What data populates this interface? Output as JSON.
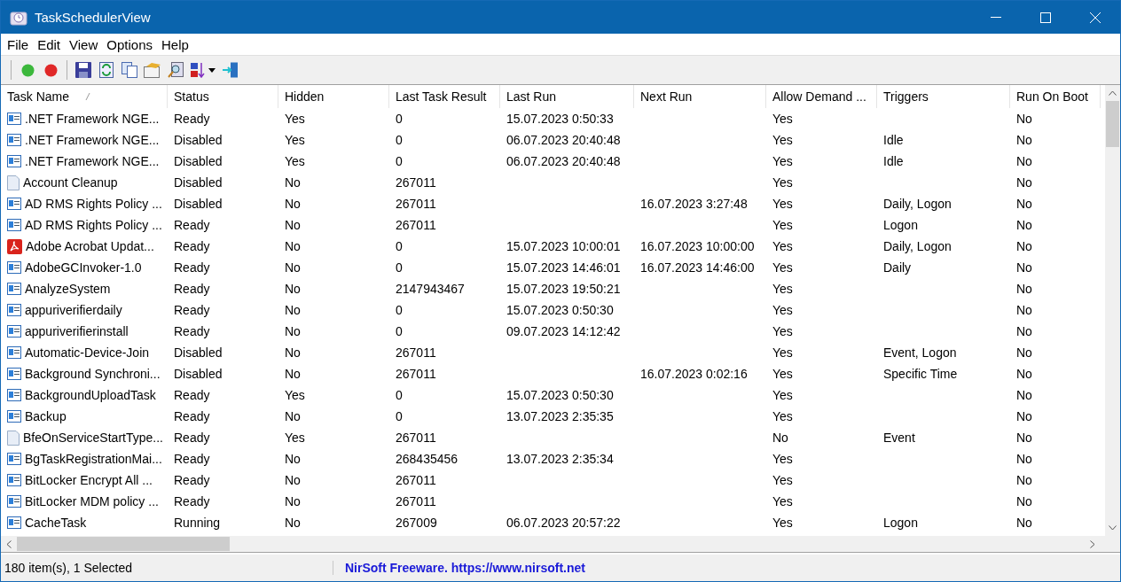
{
  "window": {
    "title": "TaskSchedulerView"
  },
  "menu": [
    "File",
    "Edit",
    "View",
    "Options",
    "Help"
  ],
  "table": {
    "columns": [
      {
        "label": "Task Name",
        "sorted": true
      },
      {
        "label": "Status",
        "sorted": false
      },
      {
        "label": "Hidden",
        "sorted": false
      },
      {
        "label": "Last Task Result",
        "sorted": false
      },
      {
        "label": "Last Run",
        "sorted": false
      },
      {
        "label": "Next Run",
        "sorted": false
      },
      {
        "label": "Allow Demand ...",
        "sorted": false
      },
      {
        "label": "Triggers",
        "sorted": false
      },
      {
        "label": "Run On Boot",
        "sorted": false
      }
    ],
    "rows": [
      {
        "kind": "task",
        "cells": [
          ".NET Framework NGE...",
          "Ready",
          "Yes",
          "0",
          "15.07.2023 0:50:33",
          "",
          "Yes",
          "",
          "No"
        ]
      },
      {
        "kind": "task",
        "cells": [
          ".NET Framework NGE...",
          "Disabled",
          "Yes",
          "0",
          "06.07.2023 20:40:48",
          "",
          "Yes",
          "Idle",
          "No"
        ]
      },
      {
        "kind": "task",
        "cells": [
          ".NET Framework NGE...",
          "Disabled",
          "Yes",
          "0",
          "06.07.2023 20:40:48",
          "",
          "Yes",
          "Idle",
          "No"
        ]
      },
      {
        "kind": "document",
        "cells": [
          "Account Cleanup",
          "Disabled",
          "No",
          "267011",
          "",
          "",
          "Yes",
          "",
          "No"
        ]
      },
      {
        "kind": "task",
        "cells": [
          "AD RMS Rights Policy ...",
          "Disabled",
          "No",
          "267011",
          "",
          "16.07.2023 3:27:48",
          "Yes",
          "Daily, Logon",
          "No"
        ]
      },
      {
        "kind": "task",
        "cells": [
          "AD RMS Rights Policy ...",
          "Ready",
          "No",
          "267011",
          "",
          "",
          "Yes",
          "Logon",
          "No"
        ]
      },
      {
        "kind": "pdf",
        "cells": [
          "Adobe Acrobat Updat...",
          "Ready",
          "No",
          "0",
          "15.07.2023 10:00:01",
          "16.07.2023 10:00:00",
          "Yes",
          "Daily, Logon",
          "No"
        ]
      },
      {
        "kind": "task",
        "cells": [
          "AdobeGCInvoker-1.0",
          "Ready",
          "No",
          "0",
          "15.07.2023 14:46:01",
          "16.07.2023 14:46:00",
          "Yes",
          "Daily",
          "No"
        ]
      },
      {
        "kind": "task",
        "cells": [
          "AnalyzeSystem",
          "Ready",
          "No",
          "2147943467",
          "15.07.2023 19:50:21",
          "",
          "Yes",
          "",
          "No"
        ]
      },
      {
        "kind": "task",
        "cells": [
          "appuriverifierdaily",
          "Ready",
          "No",
          "0",
          "15.07.2023 0:50:30",
          "",
          "Yes",
          "",
          "No"
        ]
      },
      {
        "kind": "task",
        "cells": [
          "appuriverifierinstall",
          "Ready",
          "No",
          "0",
          "09.07.2023 14:12:42",
          "",
          "Yes",
          "",
          "No"
        ]
      },
      {
        "kind": "task",
        "cells": [
          "Automatic-Device-Join",
          "Disabled",
          "No",
          "267011",
          "",
          "",
          "Yes",
          "Event, Logon",
          "No"
        ]
      },
      {
        "kind": "task",
        "cells": [
          "Background Synchroni...",
          "Disabled",
          "No",
          "267011",
          "",
          "16.07.2023 0:02:16",
          "Yes",
          "Specific Time",
          "No"
        ]
      },
      {
        "kind": "task",
        "cells": [
          "BackgroundUploadTask",
          "Ready",
          "Yes",
          "0",
          "15.07.2023 0:50:30",
          "",
          "Yes",
          "",
          "No"
        ]
      },
      {
        "kind": "task",
        "cells": [
          "Backup",
          "Ready",
          "No",
          "0",
          "13.07.2023 2:35:35",
          "",
          "Yes",
          "",
          "No"
        ]
      },
      {
        "kind": "document",
        "cells": [
          "BfeOnServiceStartType...",
          "Ready",
          "Yes",
          "267011",
          "",
          "",
          "No",
          "Event",
          "No"
        ]
      },
      {
        "kind": "task",
        "cells": [
          "BgTaskRegistrationMai...",
          "Ready",
          "No",
          "268435456",
          "13.07.2023 2:35:34",
          "",
          "Yes",
          "",
          "No"
        ]
      },
      {
        "kind": "task",
        "cells": [
          "BitLocker Encrypt All ...",
          "Ready",
          "No",
          "267011",
          "",
          "",
          "Yes",
          "",
          "No"
        ]
      },
      {
        "kind": "task",
        "cells": [
          "BitLocker MDM policy ...",
          "Ready",
          "No",
          "267011",
          "",
          "",
          "Yes",
          "",
          "No"
        ]
      },
      {
        "kind": "task",
        "cells": [
          "CacheTask",
          "Running",
          "No",
          "267009",
          "06.07.2023 20:57:22",
          "",
          "Yes",
          "Logon",
          "No"
        ]
      }
    ]
  },
  "status_bar": {
    "count": "180 item(s), 1 Selected",
    "link": "NirSoft Freeware. https://www.nirsoft.net"
  }
}
